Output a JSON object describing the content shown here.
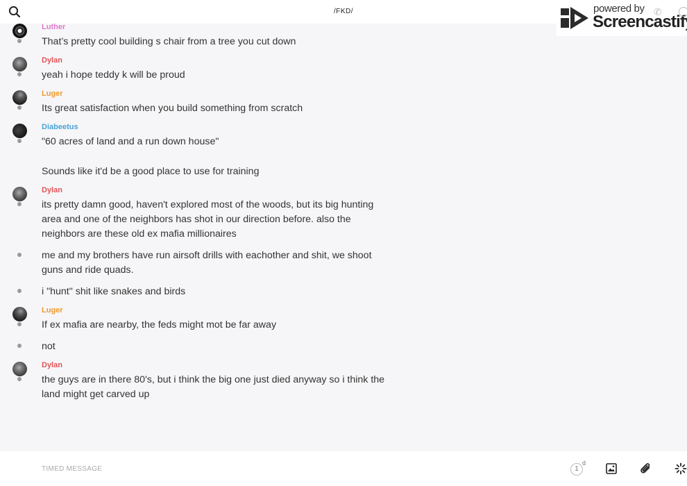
{
  "header": {
    "channel_title": "/FKD/",
    "search_icon": "search-icon"
  },
  "watermark": {
    "line1": "powered by",
    "line2": "Screencastify"
  },
  "colors": {
    "luther": "#e07ad0",
    "dylan": "#e0555a",
    "luger": "#ee9a2e",
    "diabeetus": "#4aa3d6"
  },
  "messages": [
    {
      "author": "Luther",
      "lines": [
        "That’s pretty cool building s chair from a tree you cut down"
      ]
    },
    {
      "author": "Dylan",
      "lines": [
        "yeah i hope teddy k will be proud"
      ]
    },
    {
      "author": "Luger",
      "lines": [
        "Its great satisfaction when you build something from scratch"
      ]
    },
    {
      "author": "Diabeetus",
      "lines": [
        "\"60 acres of land and a run down house\"",
        "Sounds like it'd be a good place to use for training"
      ]
    },
    {
      "author": "Dylan",
      "lines": [
        "its pretty damn good, haven't explored most of the woods, but its big hunting area and one of the neighbors has shot in our direction before. also the neighbors are these old ex mafia millionaires",
        "me and my brothers have run airsoft drills with eachother and shit, we shoot guns and ride quads.",
        "i \"hunt\" shit like snakes and birds"
      ]
    },
    {
      "author": "Luger",
      "lines": [
        "If ex mafia are nearby, the feds might mot be far away",
        "not"
      ]
    },
    {
      "author": "Dylan",
      "lines": [
        "the guys are in there 80's, but i think the big one just died anyway so i think the land might get carved up"
      ]
    }
  ],
  "composer": {
    "placeholder": "TIMED MESSAGE",
    "timer_value": "1",
    "timer_unit": "d"
  }
}
